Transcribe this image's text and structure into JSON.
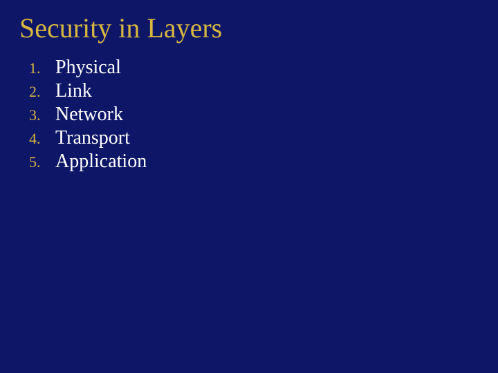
{
  "title": "Security in Layers",
  "items": [
    {
      "marker": "1.",
      "label": "Physical"
    },
    {
      "marker": "2.",
      "label": "Link"
    },
    {
      "marker": "3.",
      "label": "Network"
    },
    {
      "marker": "4.",
      "label": "Transport"
    },
    {
      "marker": "5.",
      "label": "Application"
    }
  ]
}
